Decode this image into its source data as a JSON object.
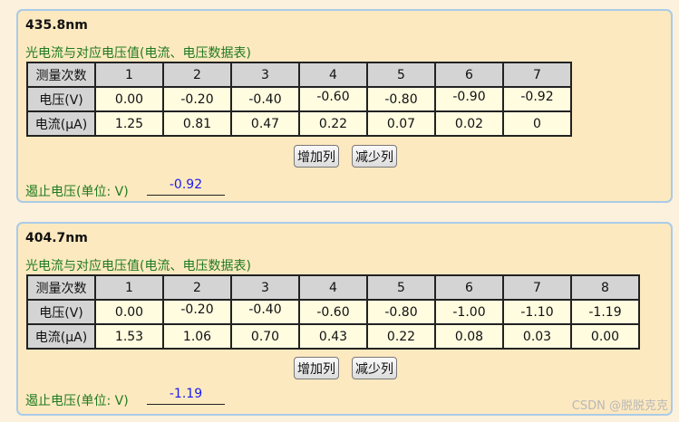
{
  "panels": [
    {
      "title": "435.8nm",
      "caption": "光电流与对应电压值(电流、电压数据表)",
      "row_headers": {
        "count": "测量次数",
        "voltage": "电压(V)",
        "current": "电流(μA)"
      },
      "columns": [
        "1",
        "2",
        "3",
        "4",
        "5",
        "6",
        "7"
      ],
      "voltage": [
        "0.00",
        "-0.20",
        "-0.40",
        "-0.60",
        "-0.80",
        "-0.90",
        "-0.92"
      ],
      "current": [
        "1.25",
        "0.81",
        "0.47",
        "0.22",
        "0.07",
        "0.02",
        "0"
      ],
      "add_button": "增加列",
      "remove_button": "减少列",
      "stop_label": "遏止电压(单位: V)",
      "stop_value": "-0.92"
    },
    {
      "title": "404.7nm",
      "caption": "光电流与对应电压值(电流、电压数据表)",
      "row_headers": {
        "count": "测量次数",
        "voltage": "电压(V)",
        "current": "电流(μA)"
      },
      "columns": [
        "1",
        "2",
        "3",
        "4",
        "5",
        "6",
        "7",
        "8"
      ],
      "voltage": [
        "0.00",
        "-0.20",
        "-0.40",
        "-0.60",
        "-0.80",
        "-1.00",
        "-1.10",
        "-1.19"
      ],
      "current": [
        "1.53",
        "1.06",
        "0.70",
        "0.43",
        "0.22",
        "0.08",
        "0.03",
        "0.00"
      ],
      "add_button": "增加列",
      "remove_button": "减少列",
      "stop_label": "遏止电压(单位: V)",
      "stop_value": "-1.19"
    }
  ],
  "watermark": "CSDN @脱脱克克"
}
